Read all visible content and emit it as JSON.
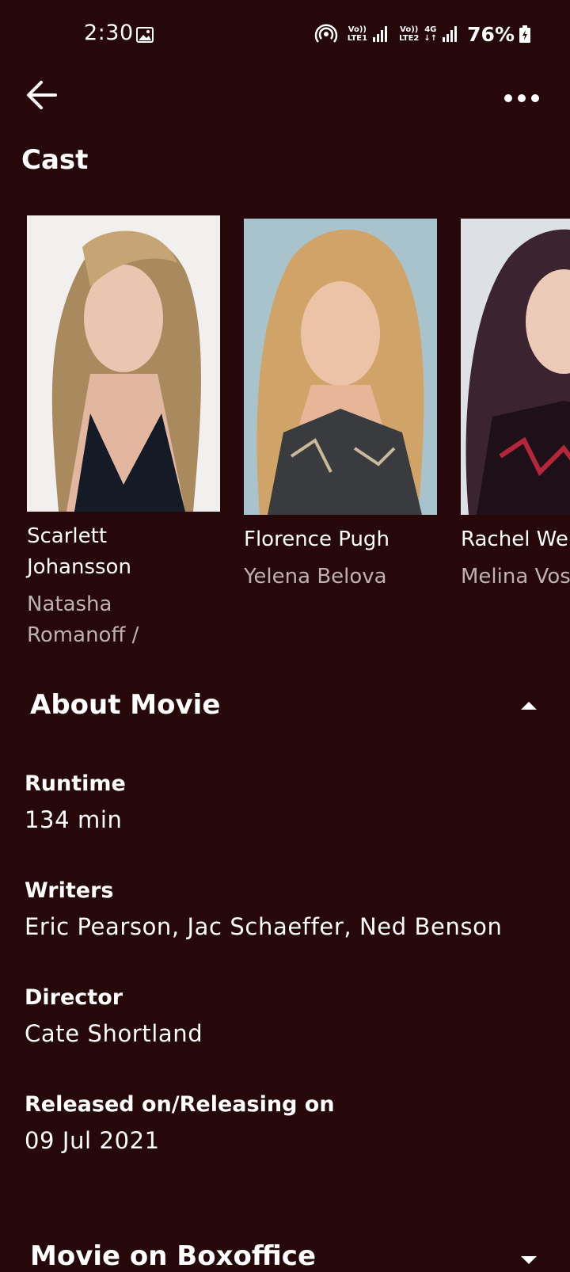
{
  "status_bar": {
    "time": "2:30",
    "sim1_top": "Vo))",
    "sim1_bottom": "LTE1",
    "sim2_top": "Vo))",
    "sim2_bottom": "LTE2",
    "network": "4G",
    "network_arrows": "↓↑",
    "battery": "76%"
  },
  "header": {
    "title": "Cast"
  },
  "cast": [
    {
      "name": "Scarlett\nJohansson",
      "role": "Natasha\nRomanoff /"
    },
    {
      "name": "Florence Pugh",
      "role": "Yelena Belova"
    },
    {
      "name": "Rachel Weisz",
      "role": "Melina Vostokoff"
    }
  ],
  "about": {
    "title": "About Movie",
    "runtime_label": "Runtime",
    "runtime_value": "134 min",
    "writers_label": "Writers",
    "writers_value": "Eric Pearson, Jac Schaeffer, Ned Benson",
    "director_label": "Director",
    "director_value": "Cate Shortland",
    "release_label": "Released on/Releasing on",
    "release_value": "09 Jul 2021"
  },
  "boxoffice": {
    "title": "Movie on Boxoffice"
  },
  "colors": {
    "background": "#26080a",
    "secondary_text": "#bdb1b2"
  }
}
